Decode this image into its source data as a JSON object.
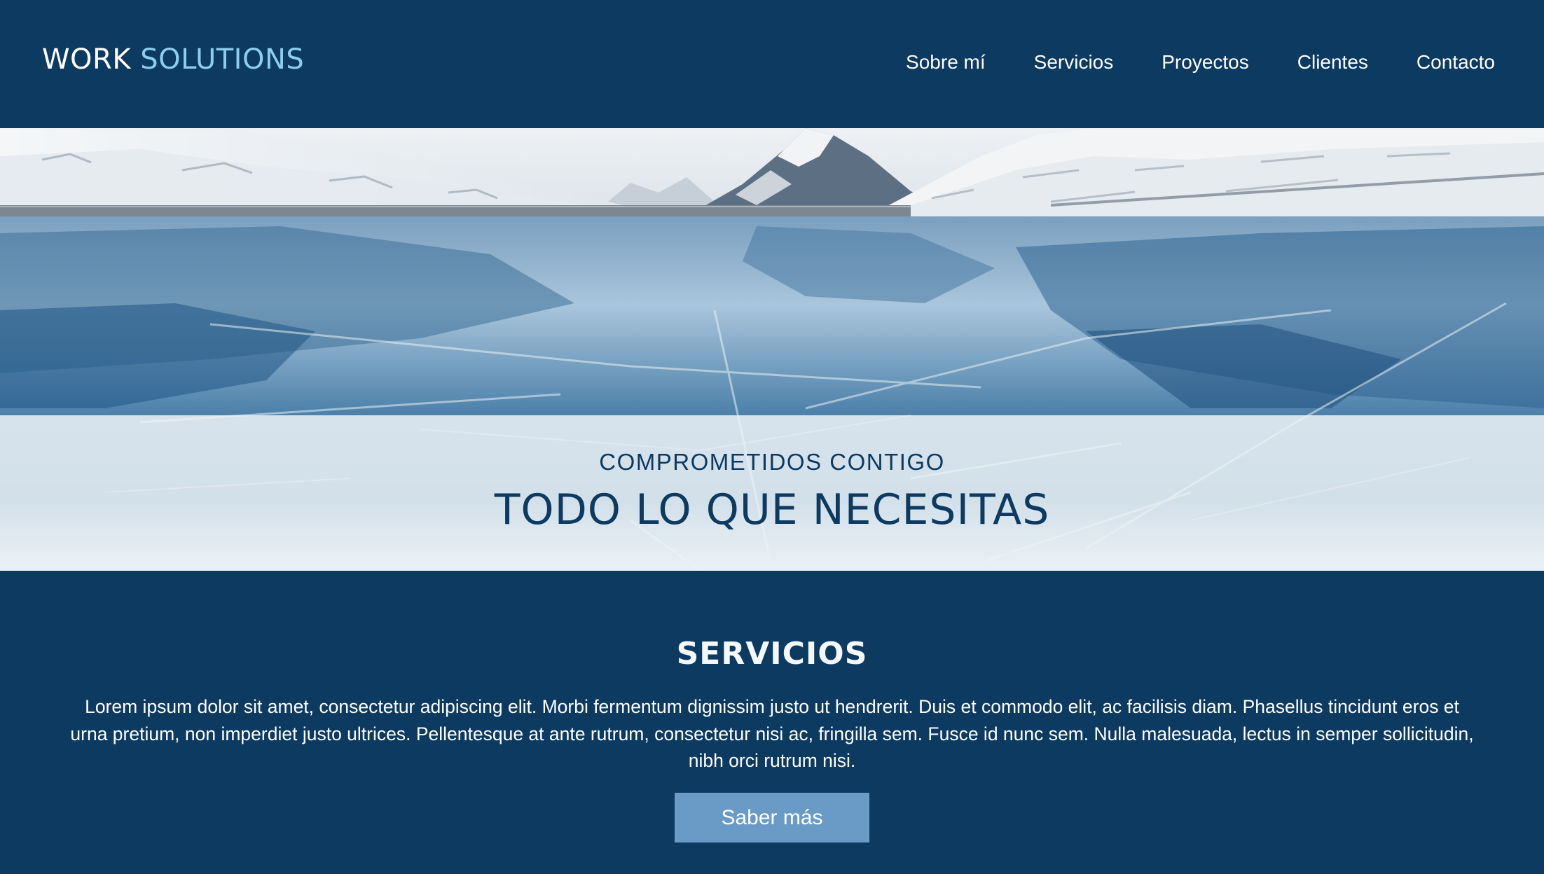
{
  "brand": {
    "word1": "WORK",
    "word2": "SOLUTIONS"
  },
  "nav": {
    "items": [
      "Sobre mí",
      "Servicios",
      "Proyectos",
      "Clientes",
      "Contacto"
    ]
  },
  "hero": {
    "image_icon": "frozen-lake-mountains-photo",
    "kicker": "COMPROMETIDOS CONTIGO",
    "headline": "TODO LO QUE NECESITAS"
  },
  "services": {
    "title": "SERVICIOS",
    "body": "Lorem ipsum dolor sit amet, consectetur adipiscing elit. Morbi fermentum dignissim justo ut hendrerit. Duis et commodo elit, ac facilisis diam. Phasellus tincidunt eros et urna pretium, non imperdiet justo ultrices. Pellentesque at ante rutrum, consectetur nisi ac, fringilla sem. Fusce id nunc sem. Nulla malesuada, lectus in semper sollicitudin, nibh orci rutrum nisi.",
    "button_label": "Saber más"
  },
  "colors": {
    "navy": "#0c3a61",
    "accent_light_blue": "#8fcdf0",
    "button_blue": "#6a9bc6"
  }
}
